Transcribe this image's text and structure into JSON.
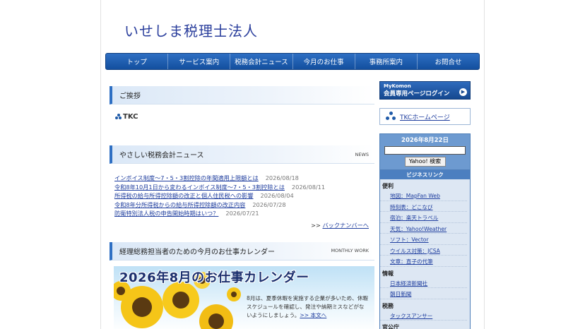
{
  "site": {
    "title": "いせしま税理士法人"
  },
  "nav": [
    "トップ",
    "サービス案内",
    "税務会計ニュース",
    "今月のお仕事",
    "事務所案内",
    "お問合せ"
  ],
  "greeting": {
    "title": "ご挨拶",
    "logo_text": "TKC"
  },
  "news": {
    "title": "やさしい税務会計ニュース",
    "sub": "NEWS",
    "items": [
      {
        "text": "インボイス制度～7・5・3割控除の年間適用上限額とは",
        "date": "2026/08/18"
      },
      {
        "text": "令和8年10月1日から変わるインボイス制度～7・5・3割控除とは",
        "date": "2026/08/11"
      },
      {
        "text": "所得税の給与所得控除額の改正と個人住民税への影響",
        "date": "2026/08/04"
      },
      {
        "text": "令和8年分所得税からの給与所得控除額の改正内容",
        "date": "2026/07/28"
      },
      {
        "text": "防衛特別法人税の申告開始時期はいつ？",
        "date": "2026/07/21"
      }
    ],
    "more_prefix": ">> ",
    "more_link": "バックナンバーへ"
  },
  "calendar": {
    "title": "経理総務担当者のための今月のお仕事カレンダー",
    "sub": "MONTHLY WORK",
    "banner_title": "2026年8月のお仕事カレンダー",
    "text": "8月は、夏季休暇を実施する企業が多いため、休暇スケジュールを確認し、発注や納期ミスなどがないようにしましょう。",
    "link": ">> 本文へ"
  },
  "sidebar": {
    "mykomon_l1": "MyKomon",
    "mykomon_l2": "会員専用ページログイン",
    "tkc_home": "TKCホームページ",
    "search_date": "2026年8月22日",
    "search_btn": "Yahoo! 検索",
    "biz_title": "ビジネスリンク",
    "categories": [
      {
        "name": "便利",
        "links": [
          "地図：MapFan Web",
          "時刻表：どこなび",
          "宿泊：楽天トラベル",
          "天気：Yahoo!Weather",
          "ソフト：Vector",
          "ウイルス対策：JCSA",
          "文章：直子の代筆"
        ]
      },
      {
        "name": "情報",
        "links": [
          "日本経済新聞社",
          "朝日新聞"
        ]
      },
      {
        "name": "税務",
        "links": [
          "タックスアンサー"
        ]
      },
      {
        "name": "官公庁",
        "links": []
      }
    ]
  }
}
